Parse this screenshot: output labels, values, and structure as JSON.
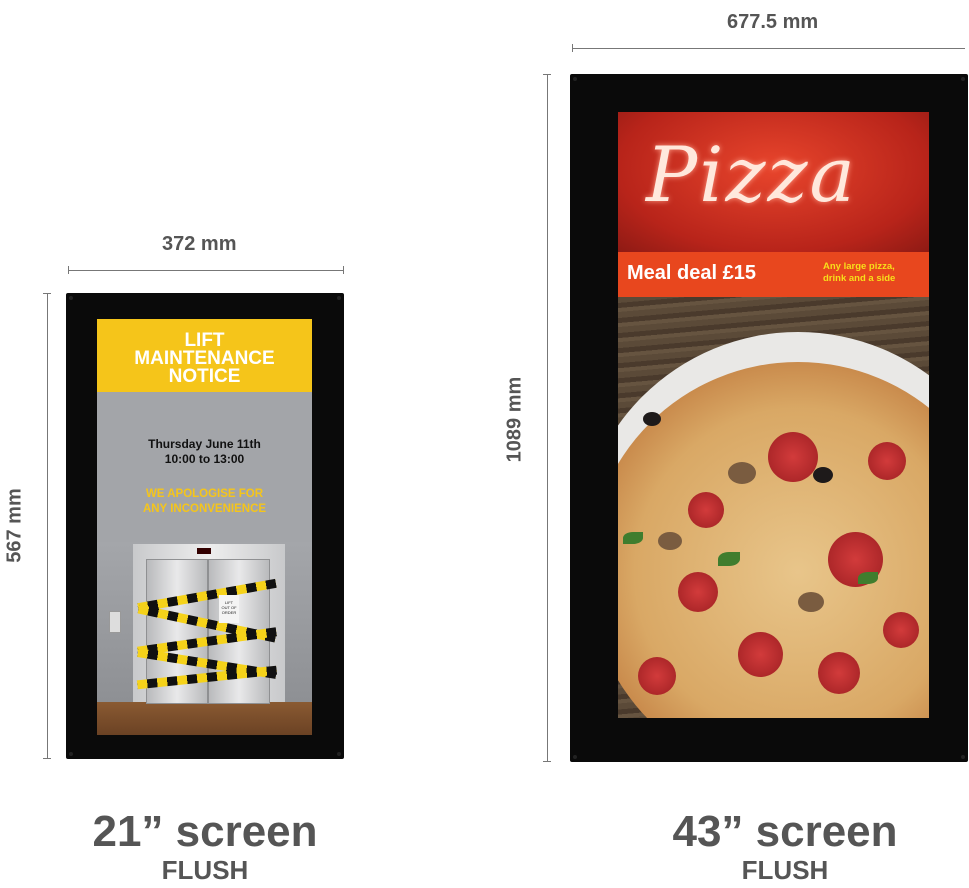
{
  "left_display": {
    "width_label": "372 mm",
    "height_label": "567 mm",
    "caption_size": "21” screen",
    "caption_type": "FLUSH",
    "poster": {
      "title_lines": [
        "LIFT",
        "MAINTENANCE",
        "NOTICE"
      ],
      "date": "Thursday June 11th",
      "time": "10:00 to 13:00",
      "apology_lines": [
        "WE APOLOGISE FOR",
        "ANY INCONVENIENCE"
      ],
      "sign_text": [
        "LIFT",
        "OUT OF",
        "ORDER"
      ]
    }
  },
  "right_display": {
    "width_label": "677.5 mm",
    "height_label": "1089 mm",
    "caption_size": "43” screen",
    "caption_type": "FLUSH",
    "poster": {
      "script_title": "Pizza",
      "offer": "Meal deal £15",
      "offer_detail_lines": [
        "Any large pizza,",
        "drink and a side"
      ]
    }
  },
  "colors": {
    "label_gray": "#555555",
    "lift_yellow": "#f5c51a",
    "pizza_red": "#e8471e",
    "offer_yellow": "#f7df1a"
  }
}
